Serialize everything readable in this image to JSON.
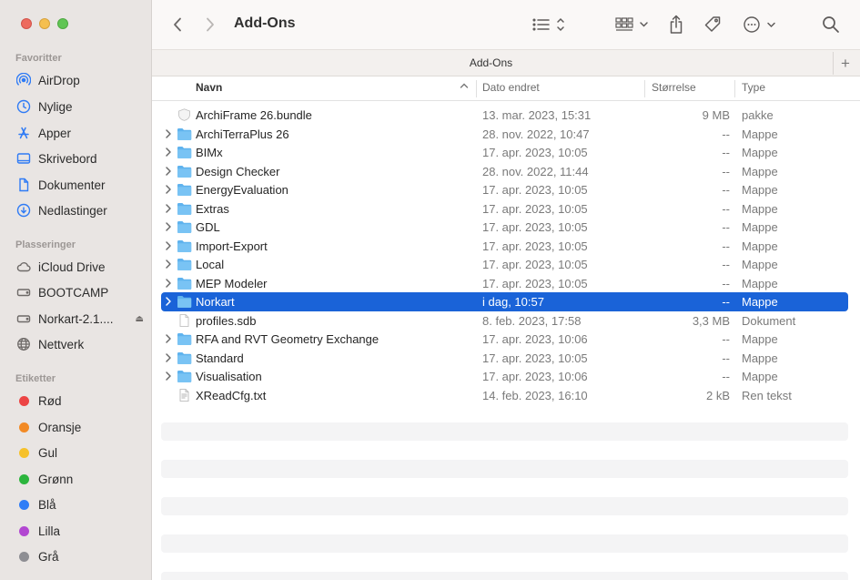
{
  "window": {
    "title": "Add-Ons",
    "path_title": "Add-Ons"
  },
  "sidebar": {
    "favorites_header": "Favoritter",
    "favorites": [
      {
        "label": "AirDrop",
        "icon": "airdrop-icon"
      },
      {
        "label": "Nylige",
        "icon": "clock-icon"
      },
      {
        "label": "Apper",
        "icon": "apps-icon"
      },
      {
        "label": "Skrivebord",
        "icon": "desktop-icon"
      },
      {
        "label": "Dokumenter",
        "icon": "document-icon"
      },
      {
        "label": "Nedlastinger",
        "icon": "download-icon"
      }
    ],
    "locations_header": "Plasseringer",
    "locations": [
      {
        "label": "iCloud Drive",
        "icon": "cloud-icon"
      },
      {
        "label": "BOOTCAMP",
        "icon": "drive-icon"
      },
      {
        "label": "Norkart-2.1....",
        "icon": "drive-icon"
      },
      {
        "label": "Nettverk",
        "icon": "globe-icon"
      }
    ],
    "tags_header": "Etiketter",
    "tags": [
      {
        "label": "Rød",
        "color": "#ec4444"
      },
      {
        "label": "Oransje",
        "color": "#f28a25"
      },
      {
        "label": "Gul",
        "color": "#f6c12a"
      },
      {
        "label": "Grønn",
        "color": "#2cb53d"
      },
      {
        "label": "Blå",
        "color": "#2f7df6"
      },
      {
        "label": "Lilla",
        "color": "#b247d1"
      },
      {
        "label": "Grå",
        "color": "#8e8e93"
      }
    ]
  },
  "columns": {
    "name": "Navn",
    "date": "Dato endret",
    "size": "Størrelse",
    "kind": "Type"
  },
  "files": [
    {
      "name": "ArchiFrame 26.bundle",
      "date": "13. mar. 2023, 15:31",
      "size": "9 MB",
      "kind": "pakke",
      "type": "bundle"
    },
    {
      "name": "ArchiTerraPlus 26",
      "date": "28. nov. 2022, 10:47",
      "size": "--",
      "kind": "Mappe",
      "type": "folder"
    },
    {
      "name": "BIMx",
      "date": "17. apr. 2023, 10:05",
      "size": "--",
      "kind": "Mappe",
      "type": "folder"
    },
    {
      "name": "Design Checker",
      "date": "28. nov. 2022, 11:44",
      "size": "--",
      "kind": "Mappe",
      "type": "folder"
    },
    {
      "name": "EnergyEvaluation",
      "date": "17. apr. 2023, 10:05",
      "size": "--",
      "kind": "Mappe",
      "type": "folder"
    },
    {
      "name": "Extras",
      "date": "17. apr. 2023, 10:05",
      "size": "--",
      "kind": "Mappe",
      "type": "folder"
    },
    {
      "name": "GDL",
      "date": "17. apr. 2023, 10:05",
      "size": "--",
      "kind": "Mappe",
      "type": "folder"
    },
    {
      "name": "Import-Export",
      "date": "17. apr. 2023, 10:05",
      "size": "--",
      "kind": "Mappe",
      "type": "folder"
    },
    {
      "name": "Local",
      "date": "17. apr. 2023, 10:05",
      "size": "--",
      "kind": "Mappe",
      "type": "folder"
    },
    {
      "name": "MEP Modeler",
      "date": "17. apr. 2023, 10:05",
      "size": "--",
      "kind": "Mappe",
      "type": "folder"
    },
    {
      "name": "Norkart",
      "date": "i dag, 10:57",
      "size": "--",
      "kind": "Mappe",
      "type": "folder",
      "selected": true
    },
    {
      "name": "profiles.sdb",
      "date": "8. feb. 2023, 17:58",
      "size": "3,3 MB",
      "kind": "Dokument",
      "type": "file"
    },
    {
      "name": "RFA and RVT Geometry Exchange",
      "date": "17. apr. 2023, 10:06",
      "size": "--",
      "kind": "Mappe",
      "type": "folder"
    },
    {
      "name": "Standard",
      "date": "17. apr. 2023, 10:05",
      "size": "--",
      "kind": "Mappe",
      "type": "folder"
    },
    {
      "name": "Visualisation",
      "date": "17. apr. 2023, 10:06",
      "size": "--",
      "kind": "Mappe",
      "type": "folder"
    },
    {
      "name": "XReadCfg.txt",
      "date": "14. feb. 2023, 16:10",
      "size": "2 kB",
      "kind": "Ren tekst",
      "type": "text"
    }
  ],
  "colors": {
    "selection": "#1a63d8",
    "folder": "#5fb3ee",
    "sidebar_accent": "#2f7bf5"
  }
}
